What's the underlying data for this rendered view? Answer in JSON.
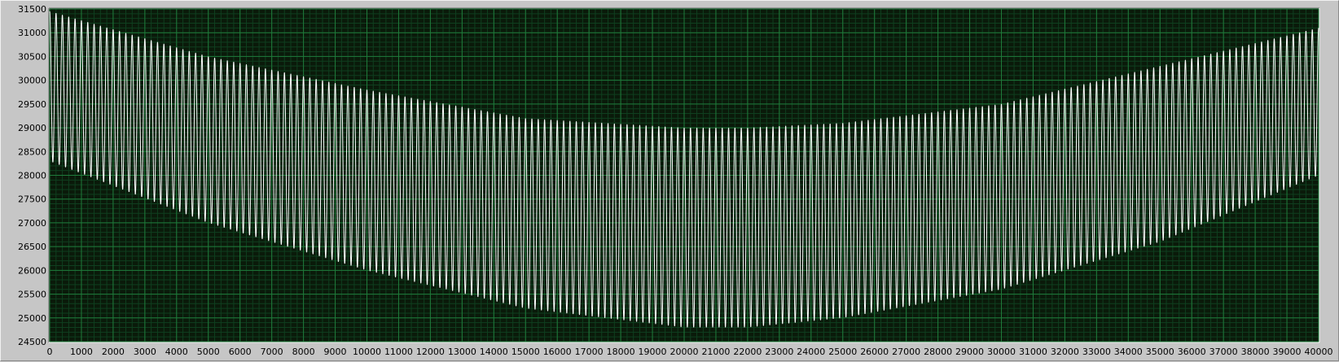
{
  "chart_data": {
    "type": "line",
    "title": "",
    "xlabel": "",
    "ylabel": "",
    "xlim": [
      0,
      40000
    ],
    "ylim": [
      24500,
      31500
    ],
    "x_ticks": [
      0,
      1000,
      2000,
      3000,
      4000,
      5000,
      6000,
      7000,
      8000,
      9000,
      10000,
      11000,
      12000,
      13000,
      14000,
      15000,
      16000,
      17000,
      18000,
      19000,
      20000,
      21000,
      22000,
      23000,
      24000,
      25000,
      26000,
      27000,
      28000,
      29000,
      30000,
      31000,
      32000,
      33000,
      34000,
      35000,
      36000,
      37000,
      38000,
      39000,
      40000
    ],
    "y_ticks": [
      24500,
      25000,
      25500,
      26000,
      26500,
      27000,
      27500,
      28000,
      28500,
      29000,
      29500,
      30000,
      30500,
      31000,
      31500
    ],
    "grid": true,
    "background_color": "#0a1a0a",
    "grid_color": "#1f7a3a",
    "minor_grid_color": "#0f3f1f",
    "line_color": "#ffffff",
    "series": [
      {
        "description": "oscillating waveform ~200 cycles",
        "cycles": 200,
        "upper_envelope": {
          "x": [
            0,
            5000,
            10000,
            15000,
            20000,
            22000,
            25000,
            30000,
            35000,
            40000
          ],
          "y": [
            31450,
            30500,
            29800,
            29200,
            29000,
            29000,
            29100,
            29500,
            30300,
            31100
          ]
        },
        "lower_envelope": {
          "x": [
            0,
            5000,
            10000,
            15000,
            20000,
            22000,
            25000,
            30000,
            35000,
            40000
          ],
          "y": [
            28300,
            27000,
            26000,
            25200,
            24800,
            24800,
            25000,
            25600,
            26600,
            28000
          ]
        }
      }
    ]
  }
}
